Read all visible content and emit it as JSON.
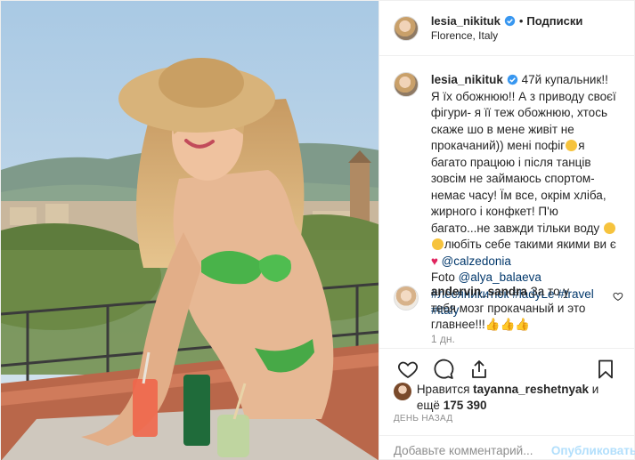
{
  "post": {
    "username": "lesia_nikituk",
    "follow_label": "Подписки",
    "separator": "•",
    "location": "Florence, Italy"
  },
  "caption": {
    "username": "lesia_nikituk",
    "text_1": "47й купальник!! Я їх обожнюю!! А з приводу своєї фігури- я її теж обожнюю, хтось скаже шо в мене живіт не прокачаний)) мені пофіг",
    "text_2": "я багато працюю і після танців зовсім не займаюсь спортом- немає часу! Їм все, окрім хліба, жирного і конфкет! П'ю багато...не завжди тільки воду",
    "text_3": "любіть себе такими якими ви є",
    "mention_1": "@calzedonia",
    "foto_label": "Foto",
    "mention_2": "@alya_balaeva",
    "hashtags": [
      "#лесяникитюк",
      "#ladyLe",
      "#travel",
      "#italy"
    ],
    "age": "1 дн."
  },
  "comment": {
    "username": "andervin_sandra",
    "text": "За то у тебя мозг прокачаный и это главнее!!!",
    "emoji": "👍👍👍"
  },
  "likes": {
    "prefix": "Нравится",
    "user": "tayanna_reshetnyak",
    "joiner": "и",
    "more_prefix": "ещё",
    "count": "175 390"
  },
  "date_label": "ДЕНЬ НАЗАД",
  "add_comment": {
    "placeholder": "Добавьте комментарий...",
    "post_label": "Опубликовать"
  },
  "icons": {
    "like": "heart-icon",
    "comment": "comment-icon",
    "share": "share-icon",
    "save": "bookmark-icon",
    "verified": "verified-badge-icon"
  },
  "colors": {
    "link": "#00376b",
    "verified": "#3897f0",
    "muted": "#8e8e8e",
    "post_disabled": "#b2dffc"
  }
}
